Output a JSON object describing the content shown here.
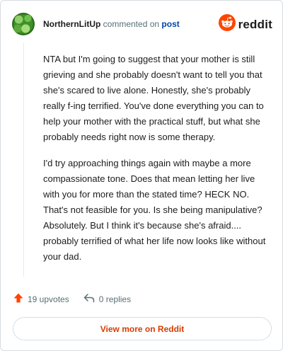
{
  "header": {
    "author": "NorthernLitUp",
    "commented_text": "commented on",
    "post_link": "post",
    "brand": "reddit"
  },
  "comment": {
    "paragraphs": [
      "NTA but I'm going to suggest that your mother is still grieving and she probably doesn't want to tell you that she's scared to live alone. Honestly, she's probably really f-ing terrified. You've done everything you can to help your mother with the practical stuff, but what she probably needs right now is some therapy.",
      "I'd try approaching things again with maybe a more compassionate tone. Does that mean letting her live with you for more than the stated time? HECK NO. That's not feasible for you. Is she being manipulative? Absolutely. But I think it's because she's afraid.... probably terrified of what her life now looks like without your dad."
    ]
  },
  "actions": {
    "upvotes": "19 upvotes",
    "replies": "0 replies"
  },
  "footer": {
    "view_more": "View more on Reddit"
  },
  "colors": {
    "brand_orange": "#ff4500",
    "link_blue": "#0045ac",
    "view_more_text": "#d93a00"
  },
  "icons": {
    "upvote": "upvote-arrow-icon",
    "reply": "reply-arrow-icon",
    "brand": "reddit-snoo-icon"
  }
}
